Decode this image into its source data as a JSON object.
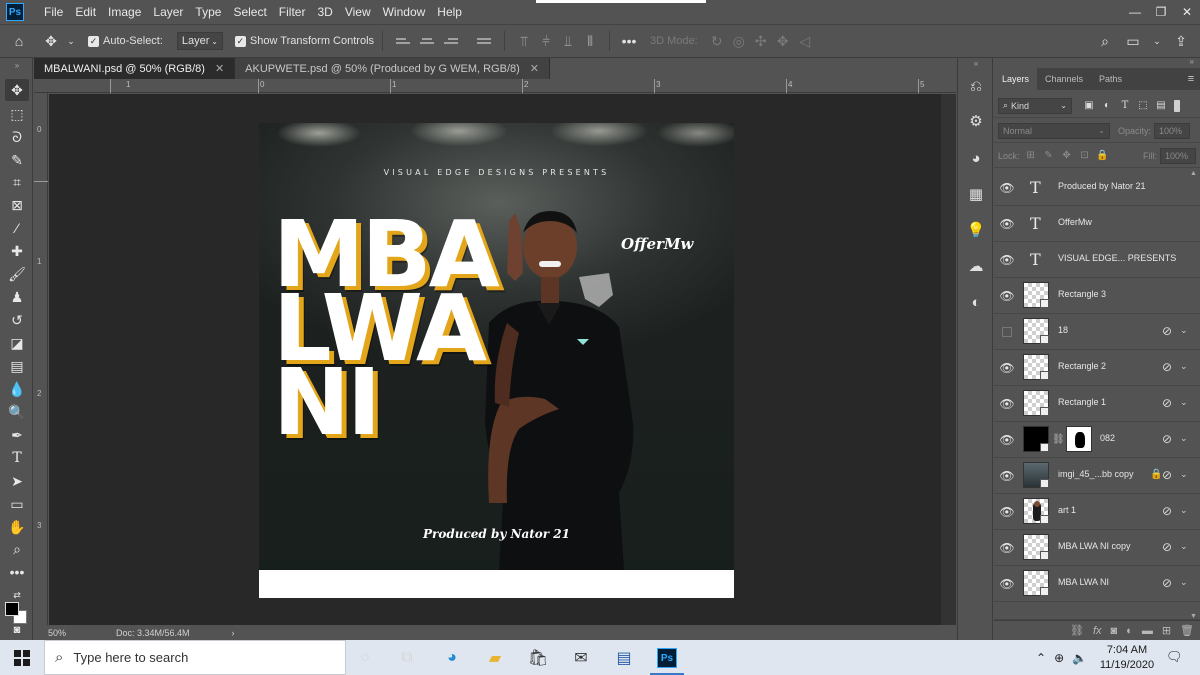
{
  "app": {
    "logo": "Ps",
    "menu": [
      "File",
      "Edit",
      "Image",
      "Layer",
      "Type",
      "Select",
      "Filter",
      "3D",
      "View",
      "Window",
      "Help"
    ]
  },
  "options_bar": {
    "auto_select_label": "Auto-Select:",
    "auto_select_target": "Layer",
    "show_transform_label": "Show Transform Controls",
    "mode_3d_label": "3D Mode:"
  },
  "tabs": [
    {
      "label": "MBALWANI.psd @ 50% (RGB/8)",
      "active": true
    },
    {
      "label": "AKUPWETE.psd @ 50% (Produced by G WEM, RGB/8)",
      "active": false
    }
  ],
  "ruler": {
    "h_labels": [
      "1",
      "0",
      "1",
      "2",
      "3",
      "4",
      "5"
    ],
    "v_labels": [
      "0",
      "1",
      "2",
      "3"
    ]
  },
  "artwork": {
    "presents": "VISUAL EDGE DESIGNS PRESENTS",
    "word1": "MBA",
    "word2": "LWA",
    "word3": "NI",
    "offer": "OfferMw",
    "produced": "Produced by Nator 21",
    "accent_color": "#e3a51a"
  },
  "status": {
    "zoom": "50%",
    "doc": "Doc: 3.34M/56.4M"
  },
  "layers_panel": {
    "tabs": [
      "Layers",
      "Channels",
      "Paths"
    ],
    "filter_kind": "Kind",
    "blend_mode": "Normal",
    "opacity_label": "Opacity:",
    "opacity_value": "100%",
    "lock_label": "Lock:",
    "fill_label": "Fill:",
    "fill_value": "100%",
    "layers": [
      {
        "name": "Produced  by Nator 21",
        "kind": "text",
        "visible": true
      },
      {
        "name": "OfferMw",
        "kind": "text",
        "visible": true
      },
      {
        "name": "VISUAL EDGE... PRESENTS",
        "kind": "text",
        "visible": true
      },
      {
        "name": "Rectangle 3",
        "kind": "shape",
        "visible": true
      },
      {
        "name": "18",
        "kind": "smart",
        "visible": false
      },
      {
        "name": "Rectangle 2",
        "kind": "smart",
        "visible": true
      },
      {
        "name": "Rectangle 1",
        "kind": "smart",
        "visible": true
      },
      {
        "name": "082",
        "kind": "masked",
        "visible": true
      },
      {
        "name": "imgi_45_...bb copy",
        "kind": "photo",
        "visible": true,
        "locked": true
      },
      {
        "name": "art 1",
        "kind": "figure",
        "visible": true
      },
      {
        "name": "MBA LWA NI copy",
        "kind": "smart",
        "visible": true
      },
      {
        "name": "MBA LWA NI",
        "kind": "smart",
        "visible": true
      }
    ]
  },
  "taskbar": {
    "search_placeholder": "Type here to search",
    "time": "7:04 AM",
    "date": "11/19/2020"
  }
}
